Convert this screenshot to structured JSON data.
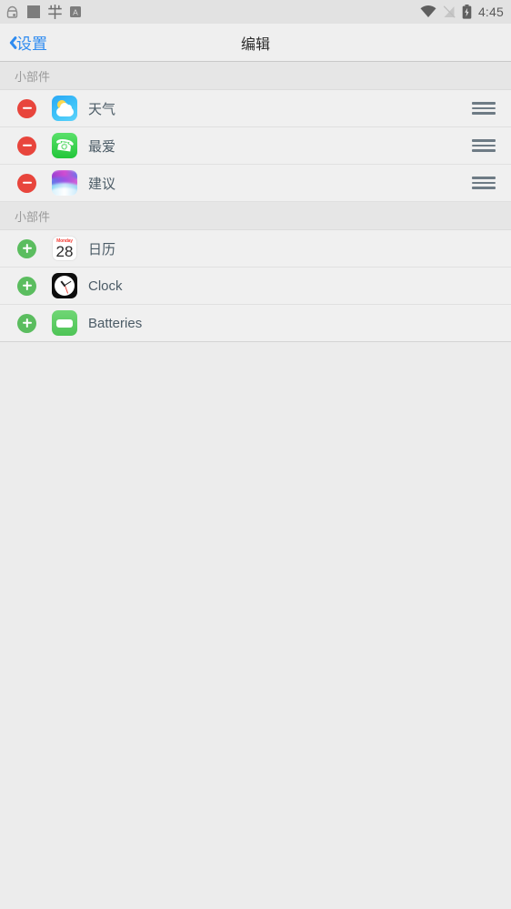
{
  "status_bar": {
    "left_icons": [
      {
        "name": "lock-ring-icon",
        "glyph": "⚿"
      },
      {
        "name": "square-app-icon",
        "glyph": "■"
      },
      {
        "name": "chinese-ime-icon",
        "glyph": "中"
      },
      {
        "name": "keyboard-layout-a-icon",
        "glyph": "A"
      }
    ],
    "right_icons": [
      {
        "name": "wifi-icon"
      },
      {
        "name": "signal-off-icon"
      },
      {
        "name": "battery-charging-icon"
      }
    ],
    "time": "4:45"
  },
  "navbar": {
    "back_label": "设置",
    "back_icon": "chevron-left-icon",
    "title": "编辑"
  },
  "sections": [
    {
      "header": "小部件",
      "rows": [
        {
          "control": "remove",
          "icon": "weather-app-icon",
          "label": "天气",
          "handle": true
        },
        {
          "control": "remove",
          "icon": "phone-favorites-app-icon",
          "label": "最爱",
          "handle": true
        },
        {
          "control": "remove",
          "icon": "siri-suggestions-app-icon",
          "label": "建议",
          "handle": true
        }
      ]
    },
    {
      "header": "小部件",
      "rows": [
        {
          "control": "add",
          "icon": "calendar-app-icon",
          "label": "日历",
          "handle": false,
          "calendar": {
            "day": "Monday",
            "date": "28"
          }
        },
        {
          "control": "add",
          "icon": "clock-app-icon",
          "label": "Clock",
          "handle": false
        },
        {
          "control": "add",
          "icon": "batteries-app-icon",
          "label": "Batteries",
          "handle": false
        }
      ]
    }
  ],
  "colors": {
    "accent_blue": "#2e8bf0",
    "remove_red": "#e8453c",
    "add_green": "#5bbd5f",
    "row_background": "#f0f0f0",
    "section_background": "#e6e6e6",
    "page_background": "#ececec",
    "label_text": "#4b5b66",
    "header_text": "#9a9a9a"
  }
}
